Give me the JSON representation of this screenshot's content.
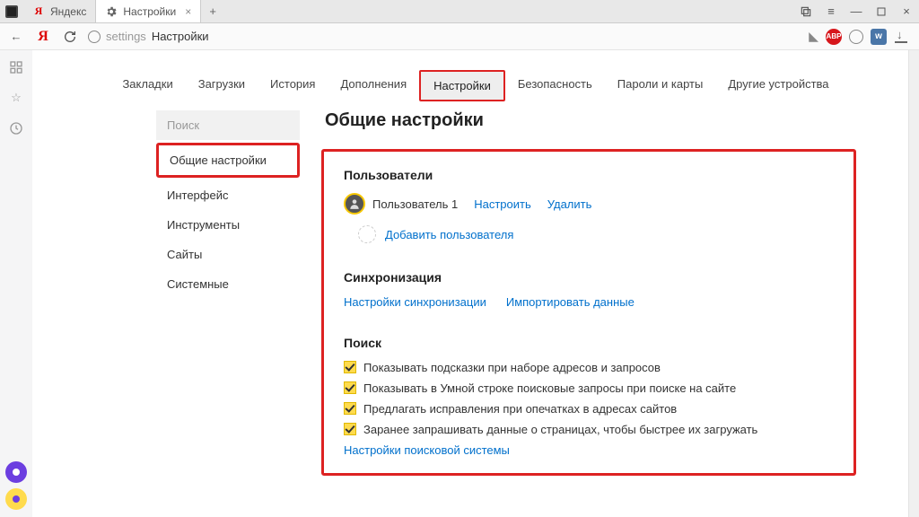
{
  "window": {
    "tabs": [
      {
        "title": "Яндекс",
        "favicon": "yandex"
      },
      {
        "title": "Настройки",
        "favicon": "gear"
      }
    ]
  },
  "toolbar": {
    "address_prefix": "settings",
    "address_current": "Настройки"
  },
  "page_tabs": {
    "items": [
      "Закладки",
      "Загрузки",
      "История",
      "Дополнения",
      "Настройки",
      "Безопасность",
      "Пароли и карты",
      "Другие устройства"
    ],
    "active_index": 4
  },
  "settings_nav": {
    "search_label": "Поиск",
    "items": [
      "Общие настройки",
      "Интерфейс",
      "Инструменты",
      "Сайты",
      "Системные"
    ],
    "active_index": 0
  },
  "main": {
    "title": "Общие настройки",
    "users": {
      "heading": "Пользователи",
      "current_name": "Пользователь 1",
      "configure": "Настроить",
      "delete": "Удалить",
      "add_user": "Добавить пользователя"
    },
    "sync": {
      "heading": "Синхронизация",
      "settings_link": "Настройки синхронизации",
      "import_link": "Импортировать данные"
    },
    "search": {
      "heading": "Поиск",
      "checks": [
        "Показывать подсказки при наборе адресов и запросов",
        "Показывать в Умной строке поисковые запросы при поиске на сайте",
        "Предлагать исправления при опечатках в адресах сайтов",
        "Заранее запрашивать данные о страницах, чтобы быстрее их загружать"
      ],
      "engine_link": "Настройки поисковой системы"
    }
  }
}
